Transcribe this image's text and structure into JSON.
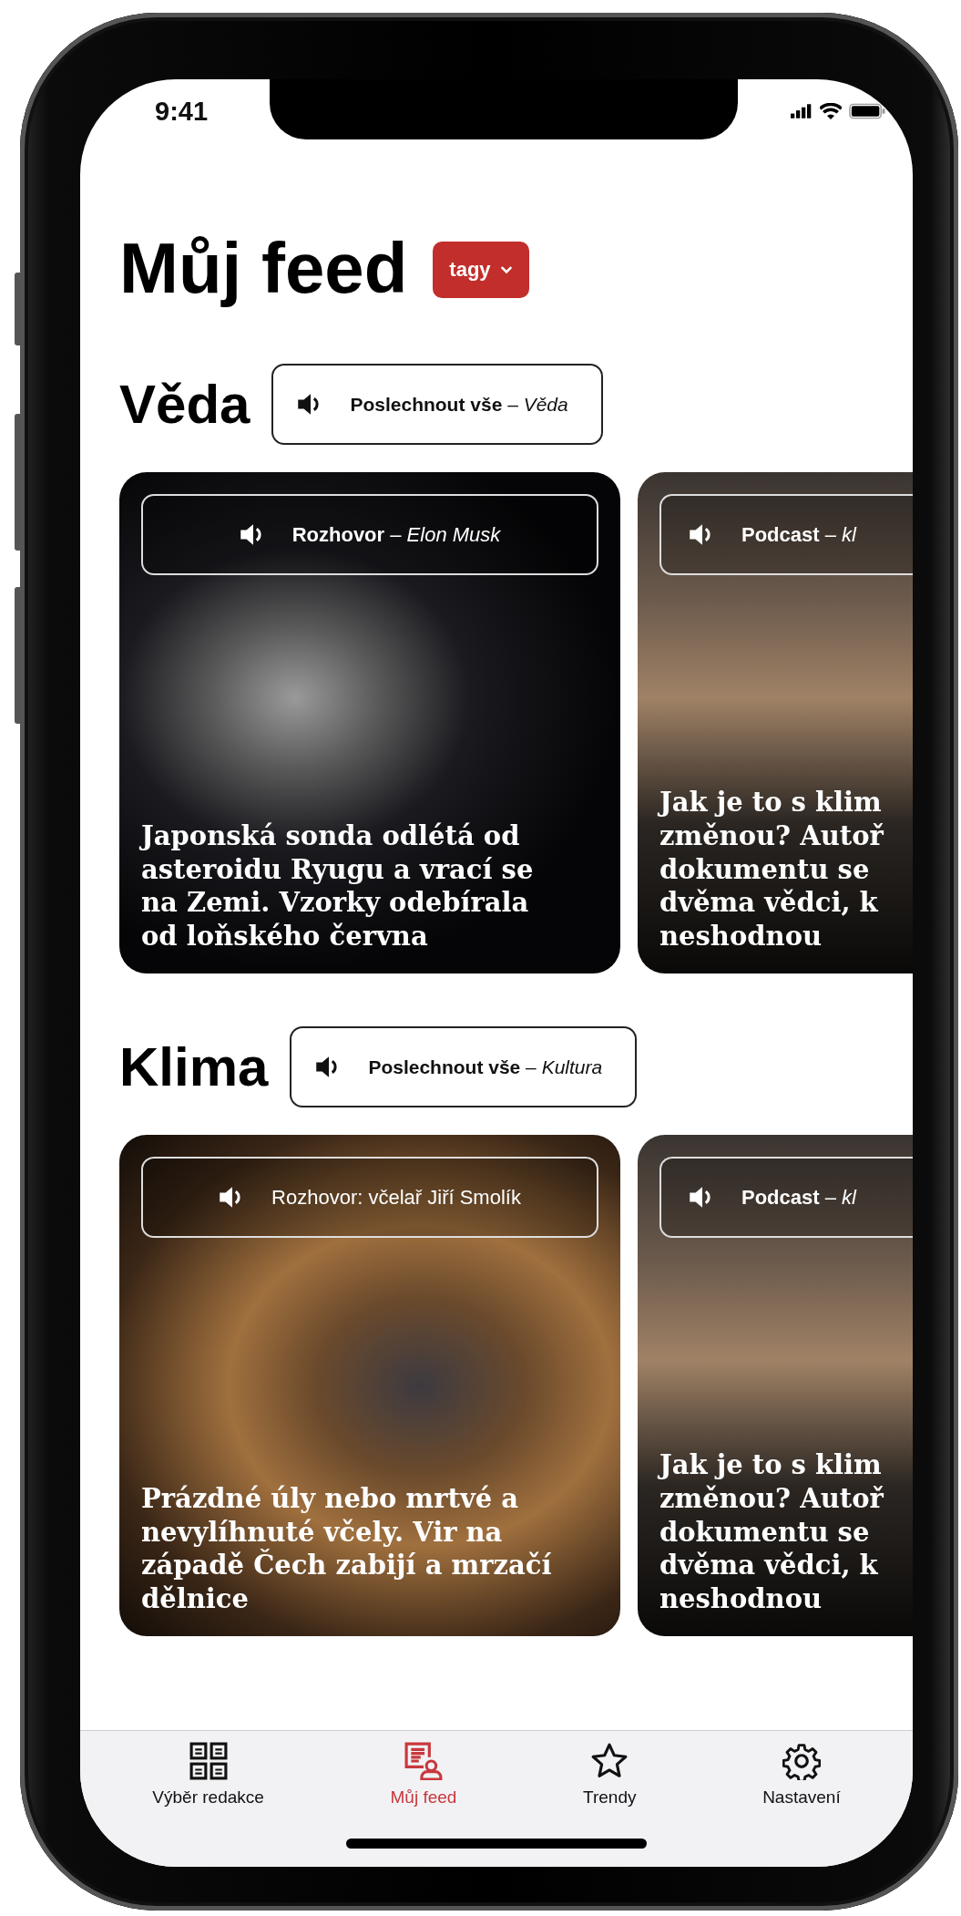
{
  "status_bar": {
    "time": "9:41"
  },
  "header": {
    "title": "Můj feed",
    "tags_button": "tagy"
  },
  "sections": [
    {
      "title": "Věda",
      "listen_button": "**Poslechnout vše** – *Věda*",
      "cards": [
        {
          "kind": "space",
          "audio": "**Rozhovor** – *Elon Musk*",
          "headline": "Japonská sonda odlétá od\nasteroidu Ryugu a vrací se\nna Zemi. Vzorky odebírala\nod loňského června"
        },
        {
          "kind": "crowd",
          "audio": "**Podcast** – *kl*",
          "headline": "Jak je to s klim\nzměnou? Autoř\ndokumentu se\ndvěma vědci, k\nneshodnou"
        }
      ]
    },
    {
      "title": "Klima",
      "listen_button": "**Poslechnout vše** – *Kultura*",
      "cards": [
        {
          "kind": "insect",
          "audio": "Rozhovor: včelař Jiří Smolík",
          "headline": "Prázdné úly nebo mrtvé a\nnevylíhnuté včely. Vir na\nzápadě Čech zabijí a mrzačí\ndělnice"
        },
        {
          "kind": "crowd",
          "audio": "**Podcast** – *kl*",
          "headline": "Jak je to s klim\nzměnou? Autoř\ndokumentu se\ndvěma vědci, k\nneshodnou"
        }
      ]
    }
  ],
  "tab_bar": [
    {
      "kind": "grid",
      "label": "Výběr redakce",
      "selected": false
    },
    {
      "kind": "feed",
      "label": "Můj feed",
      "selected": true
    },
    {
      "kind": "star",
      "label": "Trendy",
      "selected": false
    },
    {
      "kind": "gear",
      "label": "Nastavení",
      "selected": false
    }
  ]
}
